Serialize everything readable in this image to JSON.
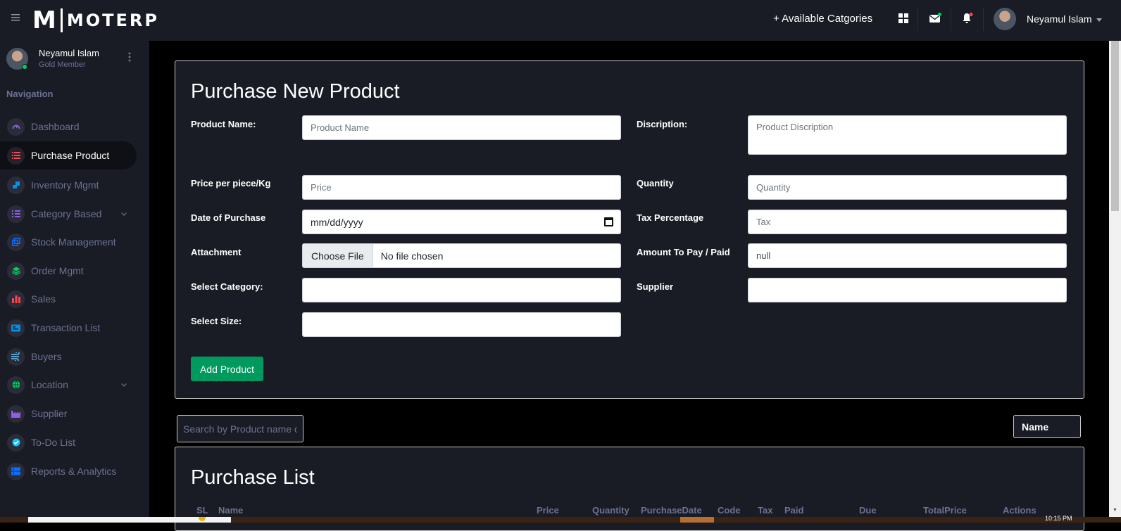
{
  "topbar": {
    "logo_m": "M",
    "logo_rest": "MOTERP",
    "categories_link": "+ Available Catgories",
    "user_name": "Neyamul Islam",
    "icons": [
      "apps-icon",
      "mail-icon",
      "bell-icon"
    ],
    "accent_colors": {
      "mail_dot": "#00d25b",
      "bell_dot": "#fc424a"
    }
  },
  "sidebar": {
    "profile_name": "Neyamul Islam",
    "profile_role": "Gold Member",
    "heading": "Navigation",
    "items": [
      {
        "label": "Dashboard",
        "icon": "speedometer-icon",
        "color": "#8f5fe8"
      },
      {
        "label": "Purchase Product",
        "icon": "list-icon",
        "color": "#fc424a",
        "active": true
      },
      {
        "label": "Inventory Mgmt",
        "icon": "inventory-icon",
        "color": "#0090e7"
      },
      {
        "label": "Category Based",
        "icon": "category-icon",
        "color": "#8f5fe8",
        "expandable": true
      },
      {
        "label": "Stock Management",
        "icon": "stock-icon",
        "color": "#0d6efd"
      },
      {
        "label": "Order Mgmt",
        "icon": "layers-icon",
        "color": "#00d25b"
      },
      {
        "label": "Sales",
        "icon": "bar-chart-icon",
        "color": "#fc424a"
      },
      {
        "label": "Transaction List",
        "icon": "card-icon",
        "color": "#0090e7"
      },
      {
        "label": "Buyers",
        "icon": "wind-icon",
        "color": "#6ac7ff"
      },
      {
        "label": "Location",
        "icon": "globe-icon",
        "color": "#00d25b",
        "expandable": true
      },
      {
        "label": "Supplier",
        "icon": "factory-icon",
        "color": "#8f5fe8"
      },
      {
        "label": "To-Do List",
        "icon": "check-circle-icon",
        "color": "#0ec5ff"
      },
      {
        "label": "Reports & Analytics",
        "icon": "server-icon",
        "color": "#0d6efd"
      }
    ]
  },
  "form": {
    "title": "Purchase New Product",
    "product_name_label": "Product Name:",
    "product_name_placeholder": "Product Name",
    "description_label": "Discription:",
    "description_placeholder": "Product Discription",
    "price_label": "Price per piece/Kg",
    "price_placeholder": "Price",
    "quantity_label": "Quantity",
    "quantity_placeholder": "Quantity",
    "date_label": "Date of Purchase",
    "date_value": "mm/dd/yyyy",
    "tax_label": "Tax Percentage",
    "tax_placeholder": "Tax",
    "attachment_label": "Attachment",
    "file_button": "Choose File",
    "file_status": "No file chosen",
    "amount_label": "Amount To Pay / Paid",
    "amount_value": "null",
    "category_label": "Select Category:",
    "supplier_label": "Supplier",
    "size_label": "Select Size:",
    "submit_label": "Add Product"
  },
  "list": {
    "search_placeholder": "Search by Product name or Code",
    "sort_value": "Name",
    "title": "Purchase List",
    "columns": [
      "SL",
      "Name",
      "Price",
      "Quantity",
      "PurchaseDate",
      "Code",
      "Tax",
      "Paid",
      "Due",
      "TotalPrice",
      "Actions"
    ]
  },
  "taskbar": {
    "clock": "10:15 PM"
  }
}
